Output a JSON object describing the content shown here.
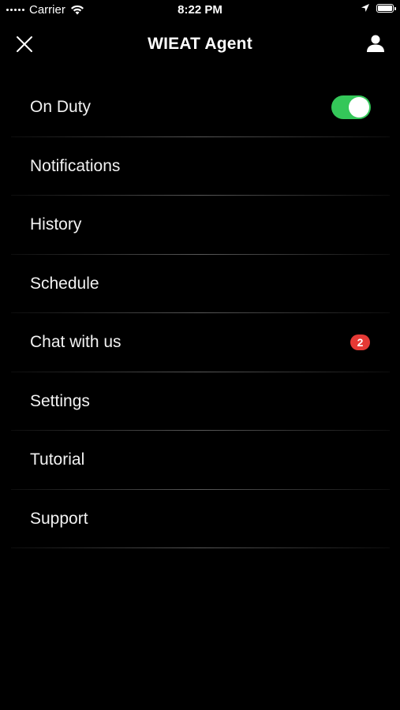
{
  "status_bar": {
    "carrier": "Carrier",
    "time": "8:22 PM"
  },
  "header": {
    "title": "WIEAT Agent",
    "close_icon": "close-icon",
    "profile_icon": "person-icon"
  },
  "menu": {
    "items": [
      {
        "label": "On Duty",
        "toggle_on": true
      },
      {
        "label": "Notifications"
      },
      {
        "label": "History"
      },
      {
        "label": "Schedule"
      },
      {
        "label": "Chat with us",
        "badge": "2"
      },
      {
        "label": "Settings"
      },
      {
        "label": "Tutorial"
      },
      {
        "label": "Support"
      }
    ]
  },
  "colors": {
    "background": "#000000",
    "toggle_on": "#34c759",
    "badge": "#e53935"
  }
}
